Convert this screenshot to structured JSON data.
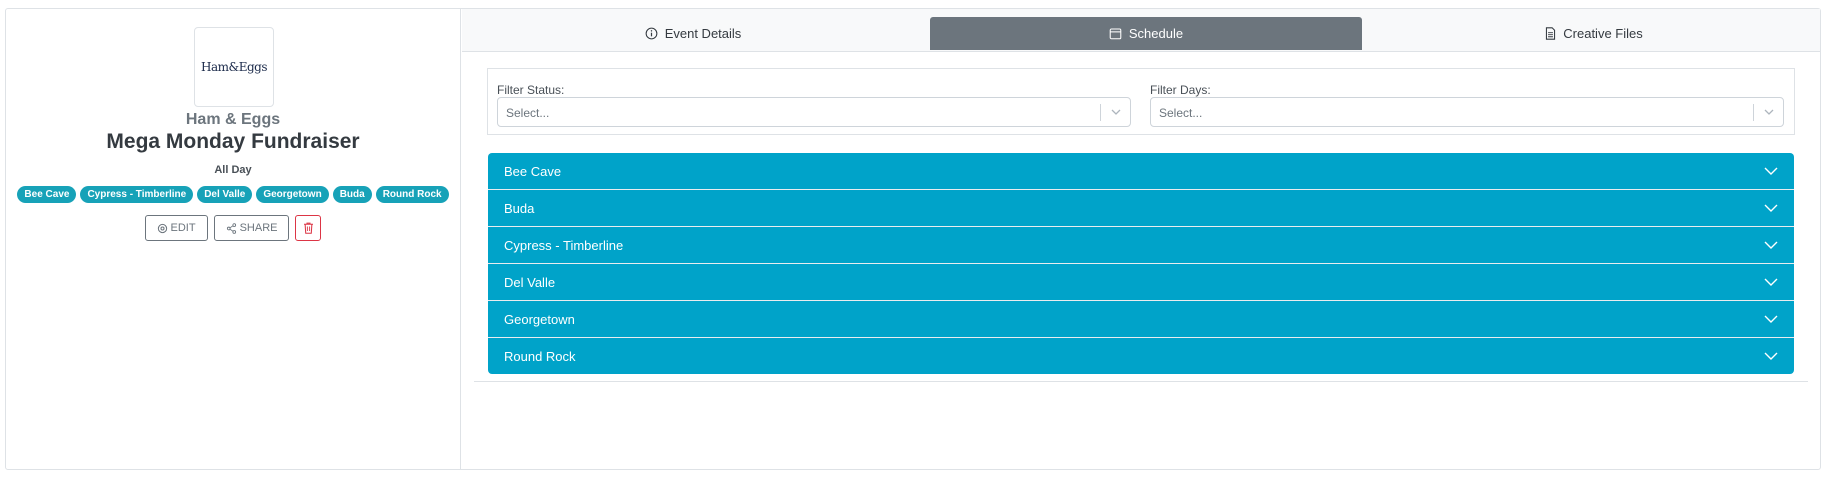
{
  "event": {
    "logo_text": "Ham&Eggs",
    "org_name": "Ham & Eggs",
    "title": "Mega Monday Fundraiser",
    "time": "All Day",
    "locations": [
      "Bee Cave",
      "Cypress - Timberline",
      "Del Valle",
      "Georgetown",
      "Buda",
      "Round Rock"
    ],
    "actions": {
      "edit_label": "EDIT",
      "share_label": "SHARE"
    }
  },
  "tabs": [
    {
      "label": "Event Details",
      "icon": "info-icon",
      "active": false
    },
    {
      "label": "Schedule",
      "icon": "calendar-icon",
      "active": true
    },
    {
      "label": "Creative Files",
      "icon": "file-icon",
      "active": false
    }
  ],
  "filters": {
    "status": {
      "label": "Filter Status:",
      "placeholder": "Select..."
    },
    "days": {
      "label": "Filter Days:",
      "placeholder": "Select..."
    }
  },
  "schedule_locations": [
    "Bee Cave",
    "Buda",
    "Cypress - Timberline",
    "Del Valle",
    "Georgetown",
    "Round Rock"
  ],
  "colors": {
    "accent": "#00a3c9",
    "tag": "#17a2b8",
    "active_tab": "#6c757d",
    "danger": "#dc3545"
  }
}
